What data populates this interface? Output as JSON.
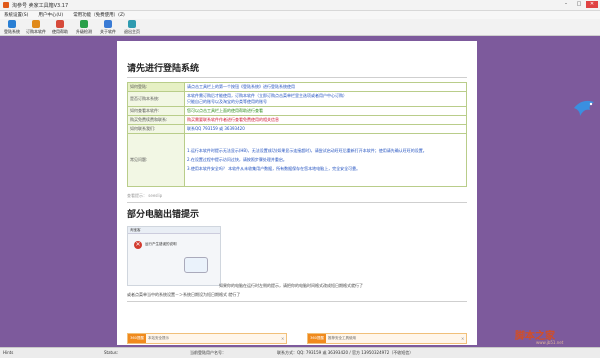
{
  "window": {
    "title": "淘参号 卖家工具箱V3.17"
  },
  "window_controls": {
    "min": "–",
    "max": "□",
    "close": "✕"
  },
  "menu": [
    "系统设置(S)",
    "用户中心(U)",
    "常用功能（免费使用）(Z)"
  ],
  "toolbar": [
    {
      "label": "登陆系统",
      "color": "#2a7fd4"
    },
    {
      "label": "订购本软件",
      "color": "#e08a1b"
    },
    {
      "label": "使用帮助",
      "color": "#d64a3a"
    },
    {
      "label": "升级检测",
      "color": "#2aa04a"
    },
    {
      "label": "关于软件",
      "color": "#3a7bd5"
    },
    {
      "label": "退出主页",
      "color": "#2f9bb0"
    }
  ],
  "page": {
    "heading": "请先进行登陆系统",
    "rows": [
      {
        "key": "如何登陆:",
        "value": "请点击工具栏上的第一个按钮《登陆系统》进行登陆系统使用"
      },
      {
        "key": "是否订购本系统:",
        "value": "本软件需订购后才能使用，订购本软件（立即订购点击菜单栏里主选项或者用户中心订购）",
        "value2": "只能自己的账号以及淘宝的分类等使用的账号"
      },
      {
        "key": "如何查看本软件:",
        "value": "您可以点击工具栏上面的使用帮助进行查看"
      },
      {
        "key": "购买免费续费和联系:",
        "value": "购买需要联系软件作者进行查看免费使用的相关信息"
      },
      {
        "key": "如何联系我们:",
        "value": "联系QQ 793159 或 36393420"
      },
      {
        "key": "常见问题:",
        "value": "1.运行本软件时提示无法显示(HB)，无法设置成功(如果显示连接超时)，请尝试启动旺旺后重新打开本软件；使用请先确认旺旺的设置。",
        "value2": "2.在设置过程中提示访问过快，请按照步骤处理并重启。",
        "value3": "3.使用本软件安全吗？ 本软件从未收集用户数据，所有数据保存在您本地电脑上，完全安全可靠。"
      }
    ],
    "note": "查看提示：",
    "note_tag": "seeslip",
    "heading2": "部分电脑出错提示",
    "err_dialog_title": "淘宝客",
    "err_msg": "运行产生错误的说明",
    "err_text": "如果你的电脑在运行时左侧的提示，请把你的电脑时间格式改成短日期格式就行了",
    "err_text2": "或者点菜单当中的系统设置－＞系统日期设为短日期格式 就行了",
    "ads": [
      {
        "tag": "360提醒",
        "text": "本站安全提示"
      },
      {
        "tag": "360提醒",
        "text": "推荐安全工具使用"
      }
    ]
  },
  "watermark": "脚本之家",
  "watermark2": "www.jb51.net",
  "status": {
    "left": "Hints",
    "status": "Status:",
    "current": "当前登陆用户名号：",
    "contact": "联系方式：QQ: 793159 或 36393420 / 官方 13950324972（不收短信）"
  }
}
